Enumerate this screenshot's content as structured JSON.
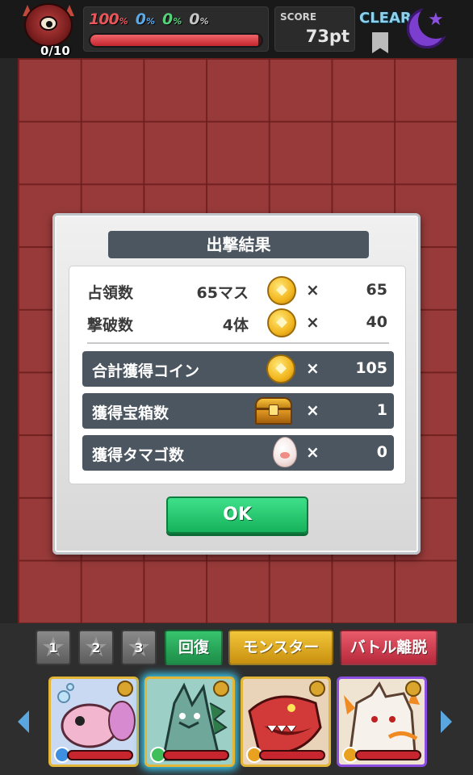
{
  "hud": {
    "boss_count": "0/10",
    "gauges": [
      {
        "value": "100",
        "unit": "%",
        "color": "red"
      },
      {
        "value": "0",
        "unit": "%",
        "color": "blue"
      },
      {
        "value": "0",
        "unit": "%",
        "color": "green"
      },
      {
        "value": "0",
        "unit": "%",
        "color": "gray"
      }
    ],
    "gauge_fill_fraction": 0.98,
    "score_label": "SCORE",
    "score_value": "73pt",
    "clear_label": "CLEAR",
    "icons": [
      "boss-monster-icon",
      "clear-ribbon-icon",
      "crescent-moon-icon"
    ]
  },
  "result": {
    "title": "出撃結果",
    "rows": [
      {
        "label": "占領数",
        "amount": "65マス",
        "multiplier": "×",
        "value": "65",
        "icon": "coin-icon"
      },
      {
        "label": "撃破数",
        "amount": "4体",
        "multiplier": "×",
        "value": "40",
        "icon": "coin-icon"
      }
    ],
    "totals": [
      {
        "label": "合計獲得コイン",
        "multiplier": "×",
        "value": "105",
        "icon": "coin-icon"
      },
      {
        "label": "獲得宝箱数",
        "multiplier": "×",
        "value": "1",
        "icon": "treasure-chest-icon"
      },
      {
        "label": "獲得タマゴ数",
        "multiplier": "×",
        "value": "0",
        "icon": "egg-icon"
      }
    ],
    "ok_label": "OK"
  },
  "bottom": {
    "slots": [
      "1",
      "2",
      "3"
    ],
    "heal_label": "回復",
    "monster_label": "モンスター",
    "leave_label": "バトル離脱"
  },
  "colors": {
    "board": "#983a3a",
    "accent_green": "#16b25b",
    "panel_dark": "#4c5660",
    "heal": "#1e8d48",
    "monster": "#c9900f",
    "leave": "#b52a3c"
  }
}
